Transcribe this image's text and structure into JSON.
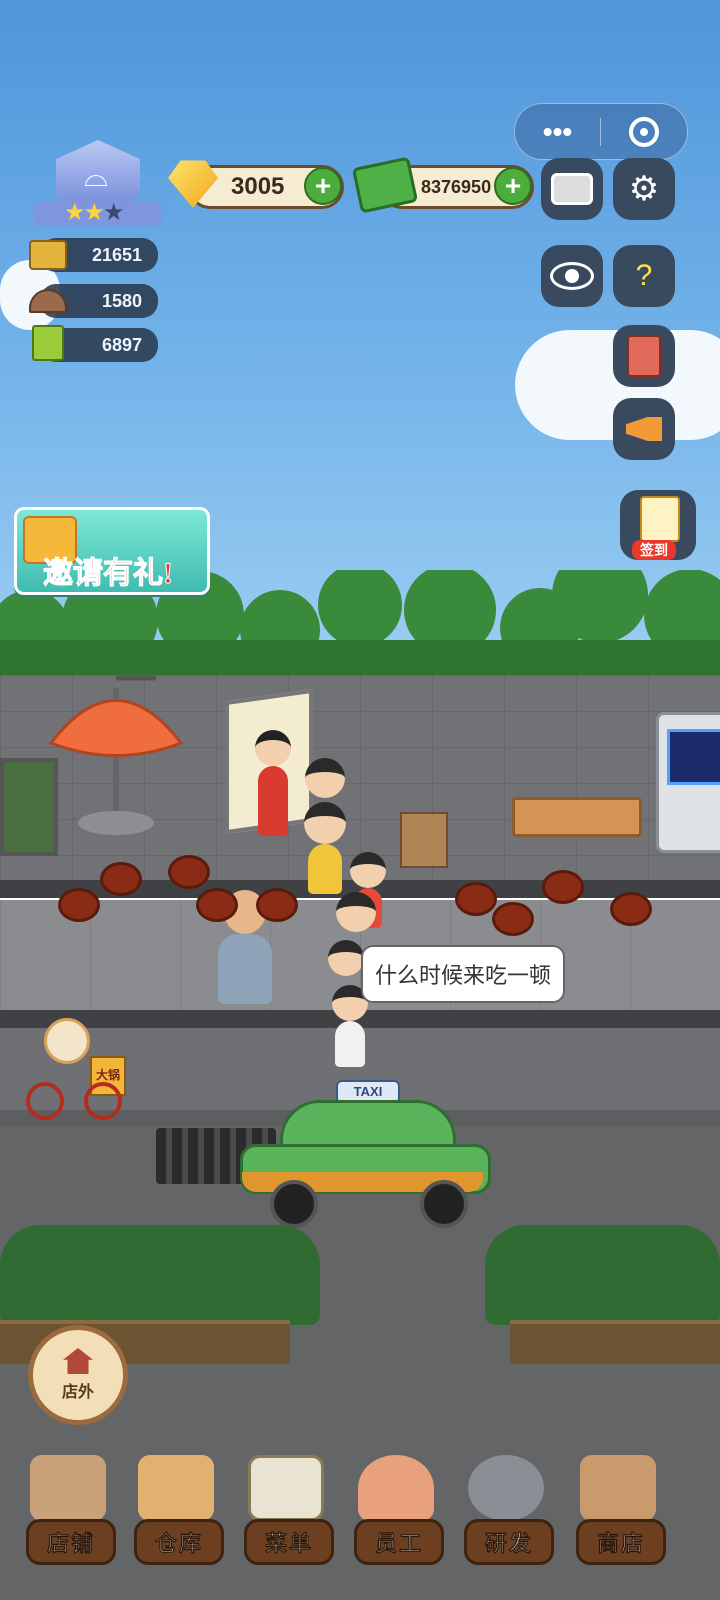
{
  "hud": {
    "gems": "3005",
    "cash": "8376950",
    "stats": [
      {
        "icon": "counter-icon",
        "value": "21651"
      },
      {
        "icon": "cloche-icon",
        "value": "1580"
      },
      {
        "icon": "recipe-book-icon",
        "value": "6897"
      }
    ],
    "level_stars": 2
  },
  "banner": {
    "invite_label": "邀请有礼!"
  },
  "signin": {
    "label": "签到"
  },
  "scene": {
    "speech_bubble": "什么时候来吃一顿",
    "delivery_box": "大锅",
    "taxi_sign": "TAXI"
  },
  "outside_button": {
    "label": "店外"
  },
  "nav": [
    {
      "label": "店铺",
      "icon": "shop-front-icon",
      "color": "#c9a27a"
    },
    {
      "label": "仓库",
      "icon": "boxes-icon",
      "color": "#e2b071"
    },
    {
      "label": "菜单",
      "icon": "menu-clipboard-icon",
      "color": "#e9e4d2"
    },
    {
      "label": "员工",
      "icon": "staff-icon",
      "color": "#e9a07c"
    },
    {
      "label": "研发",
      "icon": "wok-icon",
      "color": "#8a8f95"
    },
    {
      "label": "商店",
      "icon": "store-icon",
      "color": "#c99a6b"
    }
  ]
}
